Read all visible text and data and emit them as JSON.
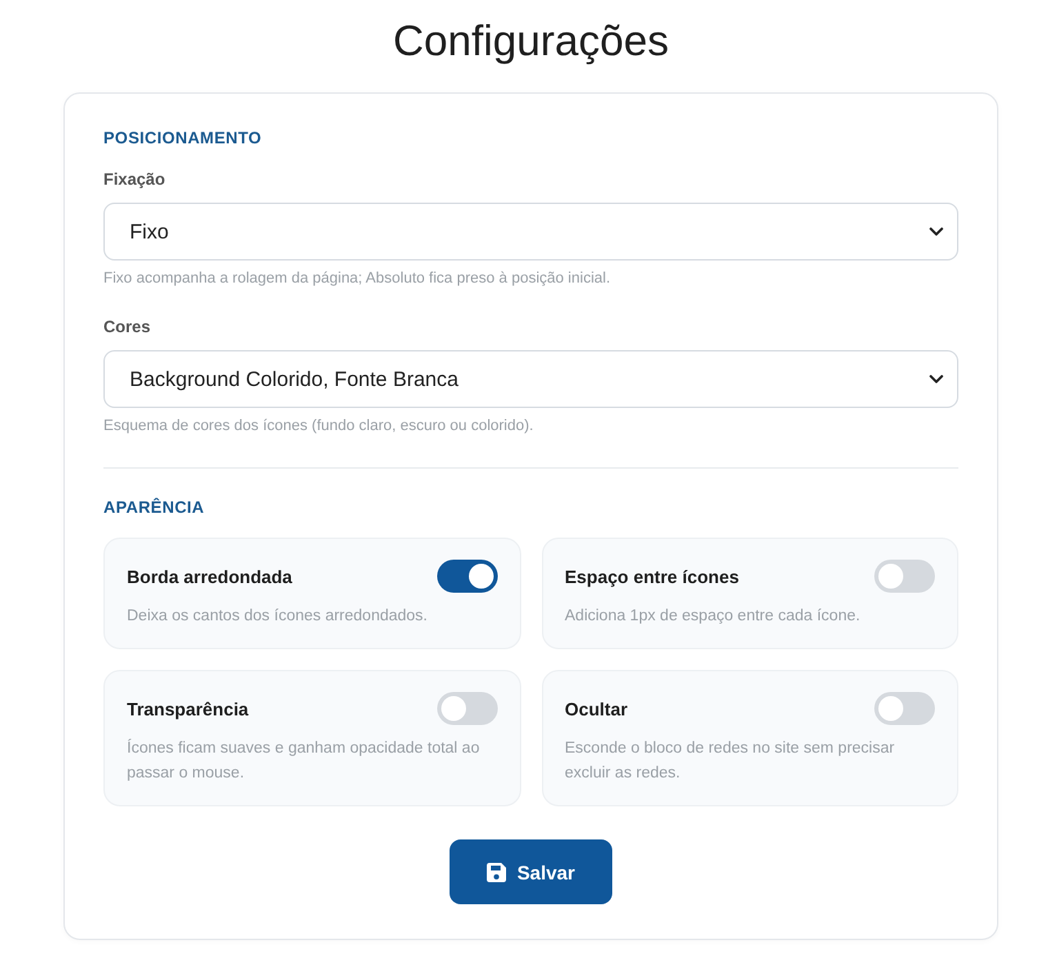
{
  "page": {
    "title": "Configurações"
  },
  "sections": [
    {
      "kind": "fields",
      "heading": "POSICIONAMENTO",
      "fields": [
        {
          "label": "Fixação",
          "value": "Fixo",
          "hint": "Fixo acompanha a rolagem da página; Absoluto fica preso à posição inicial."
        },
        {
          "label": "Cores",
          "value": "Background Colorido, Fonte Branca",
          "hint": "Esquema de cores dos ícones (fundo claro, escuro ou colorido)."
        }
      ]
    },
    {
      "kind": "toggles",
      "heading": "APARÊNCIA",
      "toggles": [
        {
          "label": "Borda arredondada",
          "description": "Deixa os cantos dos ícones arredondados.",
          "on": true
        },
        {
          "label": "Espaço entre ícones",
          "description": "Adiciona 1px de espaço entre cada ícone.",
          "on": false
        },
        {
          "label": "Transparência",
          "description": "Ícones ficam suaves e ganham opacidade total ao passar o mouse.",
          "on": false
        },
        {
          "label": "Ocultar",
          "description": "Esconde o bloco de redes no site sem precisar excluir as redes.",
          "on": false
        }
      ]
    }
  ],
  "save_button": {
    "label": "Salvar"
  }
}
